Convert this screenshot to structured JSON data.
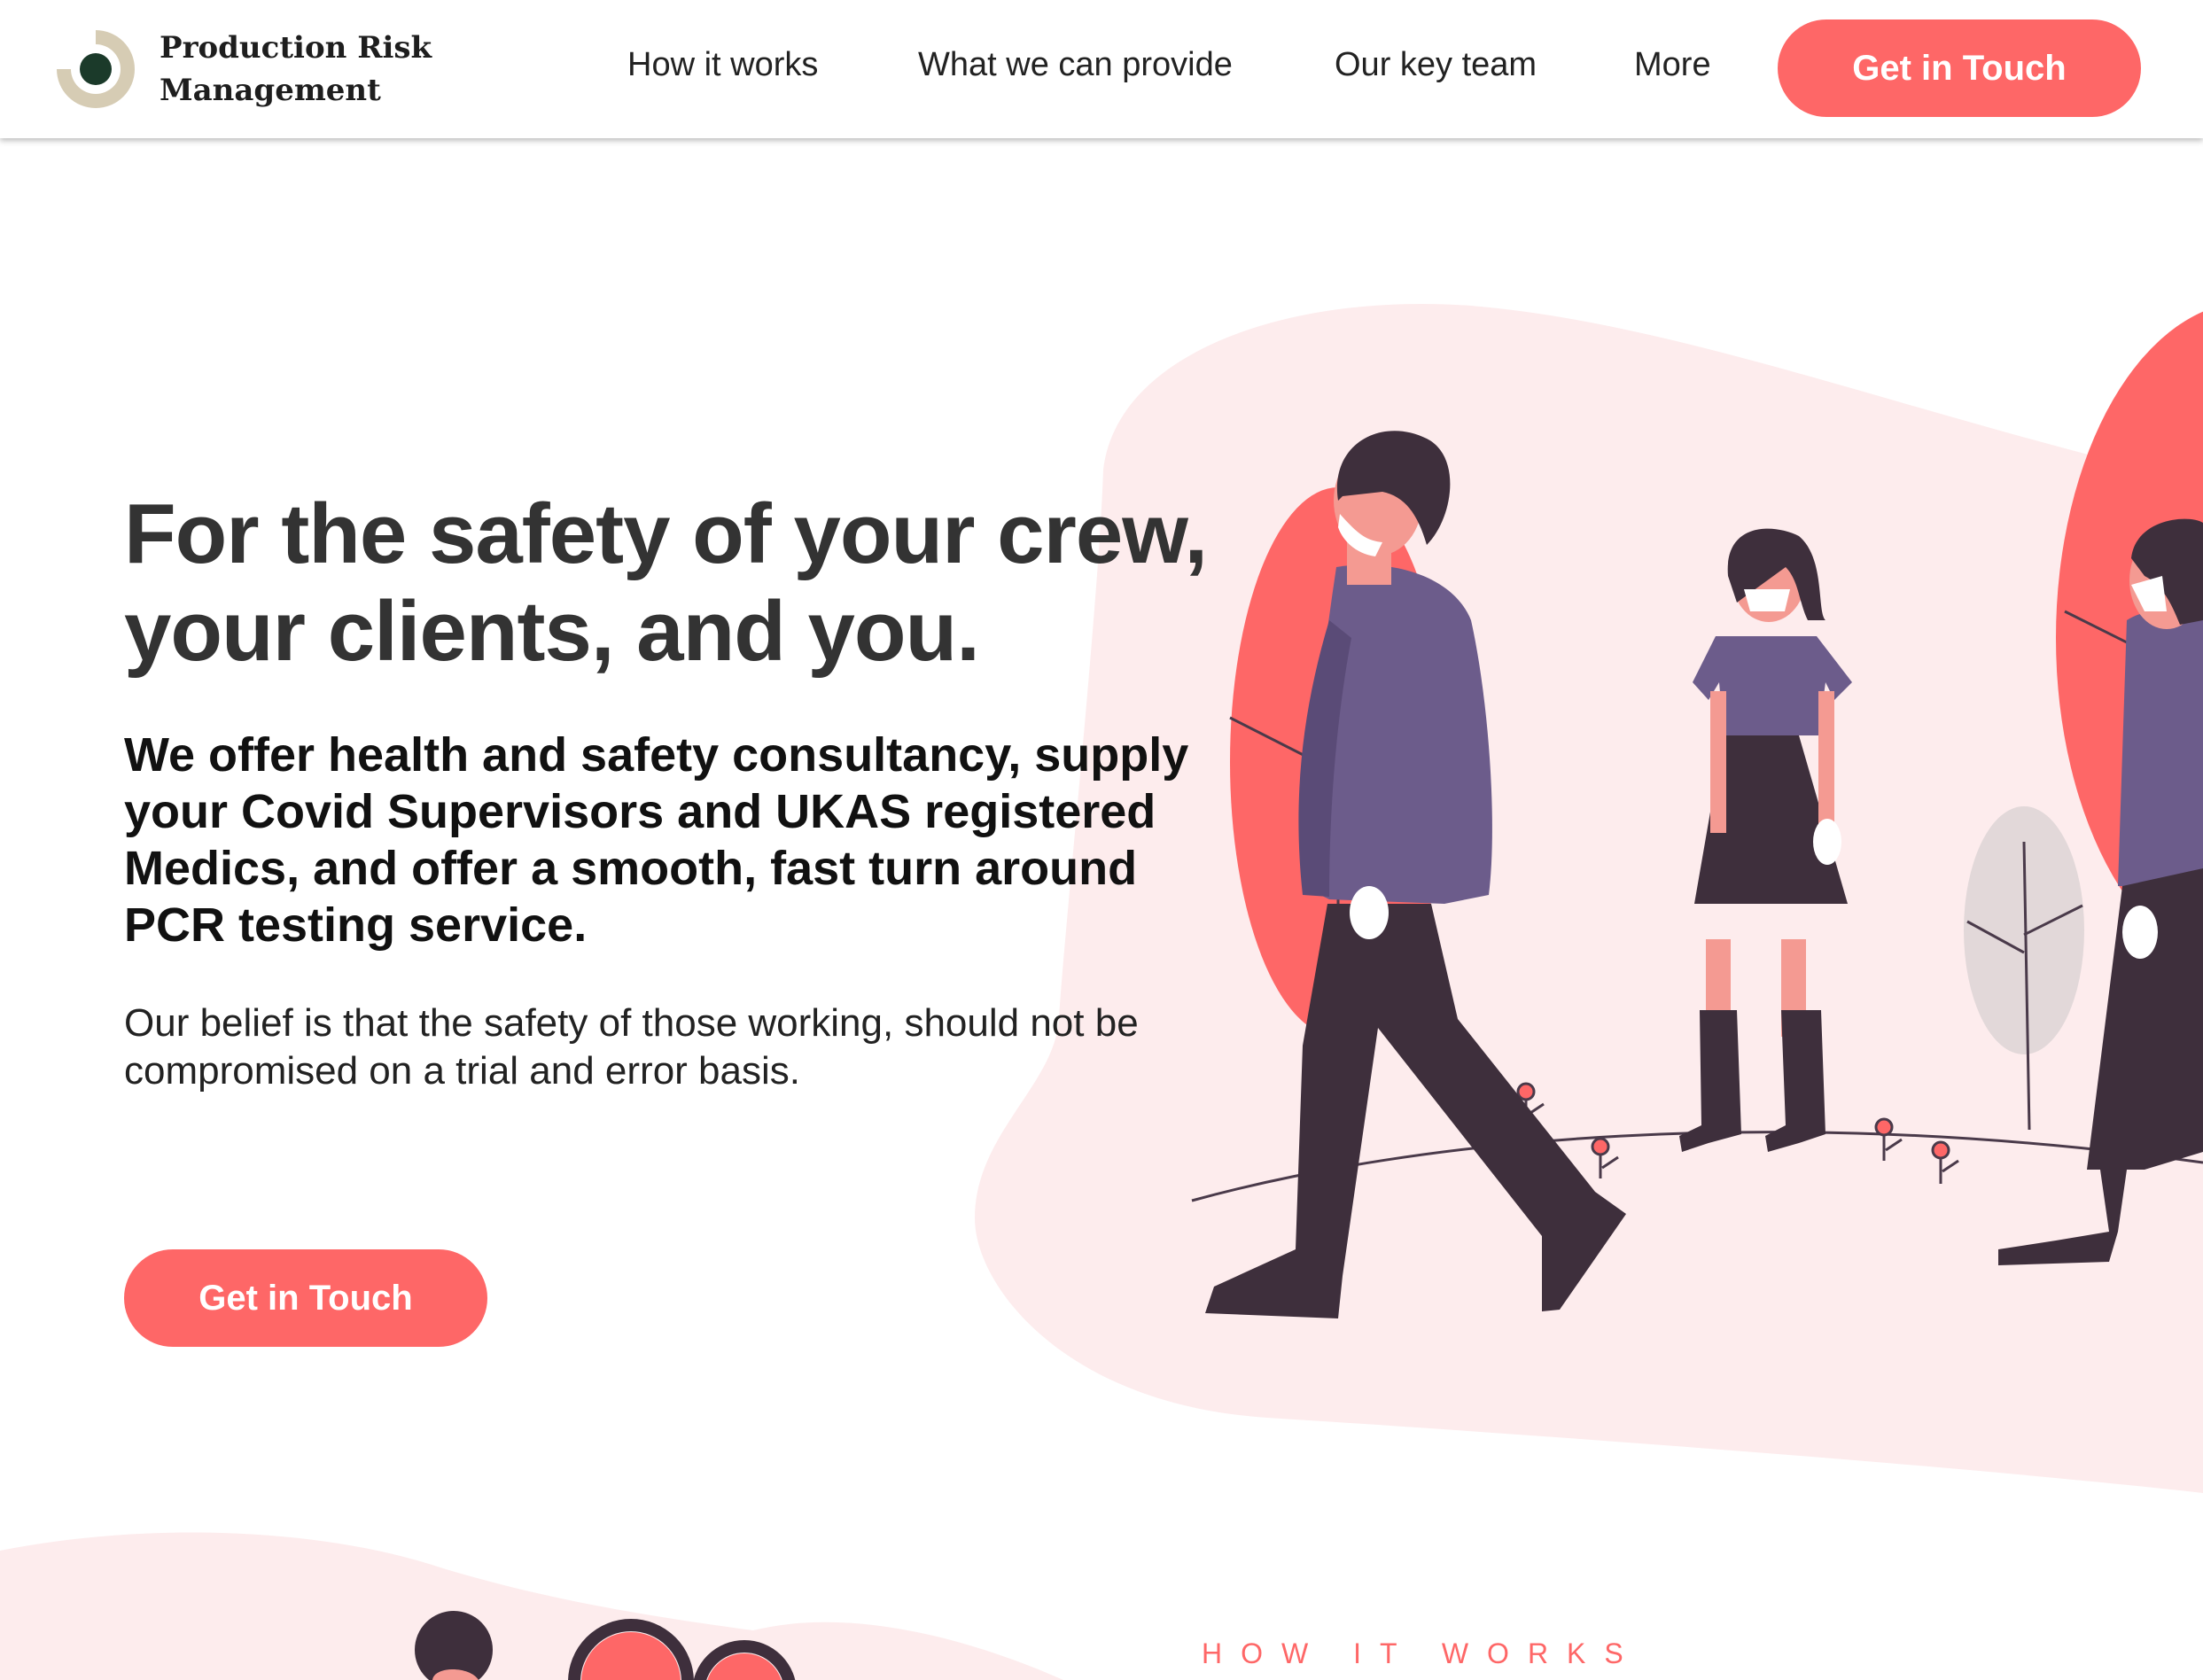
{
  "header": {
    "brand_line1": "Production Risk",
    "brand_line2": "Management",
    "nav": [
      {
        "label": "How it works"
      },
      {
        "label": "What we can provide"
      },
      {
        "label": "Our key team"
      },
      {
        "label": "More"
      }
    ],
    "cta_label": "Get in Touch"
  },
  "hero": {
    "headline_line1": "For the safety of your crew,",
    "headline_line2": "your clients, and you.",
    "subheadline": "We offer health and safety consultancy, supply your Covid Supervisors and UKAS registered Medics, and offer a smooth, fast turn around PCR testing service.",
    "body": "Our belief is that the safety of those working, should not be compromised on a trial and error basis.",
    "cta_label": "Get in Touch"
  },
  "next_section": {
    "label": "HOW IT WORKS"
  },
  "colors": {
    "accent": "#fe6767",
    "blob": "#fdeced",
    "jacket": "#6c5c8b",
    "pants": "#3e2f3c",
    "skin": "#f49a92",
    "text": "#333333"
  }
}
